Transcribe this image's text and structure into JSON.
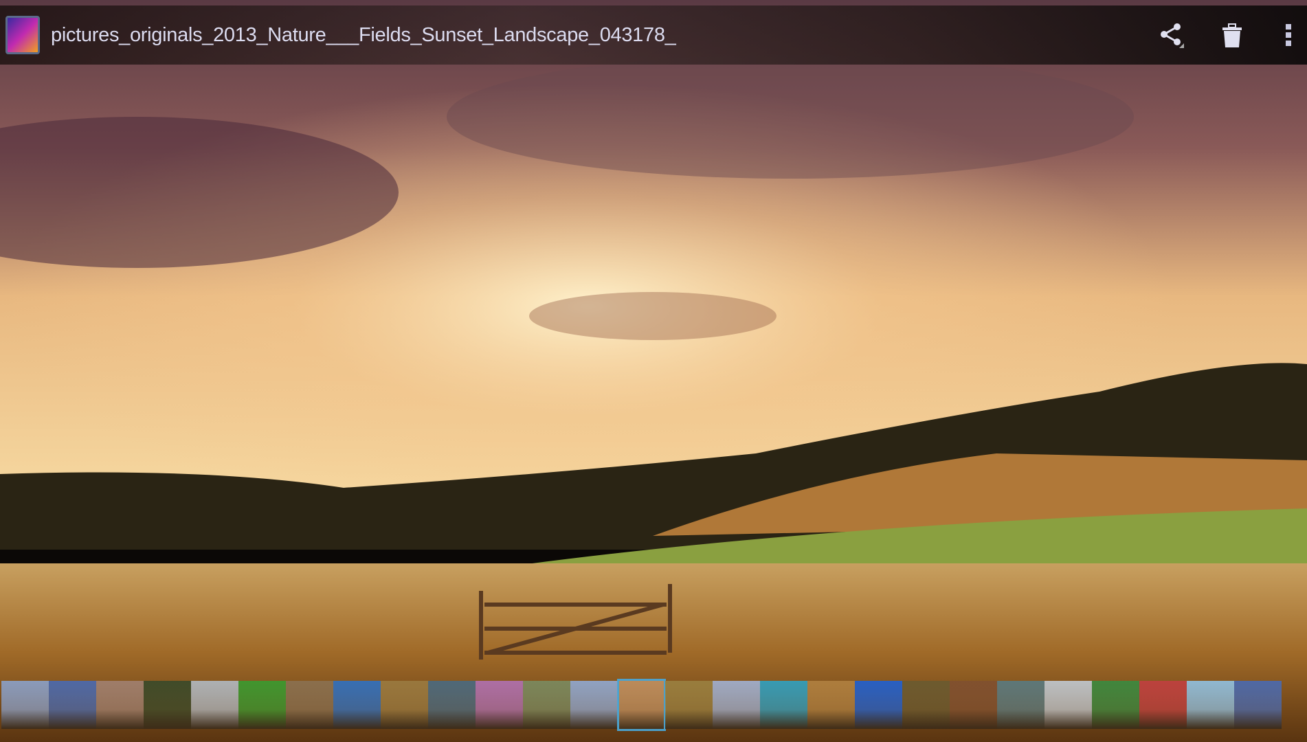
{
  "header": {
    "title": "pictures_originals_2013_Nature___Fields_Sunset_Landscape_043178_"
  },
  "actions": {
    "share": "share-icon",
    "delete": "trash-icon",
    "overflow": "more-vert-icon"
  },
  "filmstrip": {
    "selected_index": 13,
    "thumbnails": [
      "#8aa0c8",
      "#4a6ab0",
      "#a08070",
      "#3a4a2a",
      "#b0b8c0",
      "#3a9a30",
      "#8a7050",
      "#3070c0",
      "#9a7a40",
      "#4a6a80",
      "#b070b0",
      "#7a8a60",
      "#90a8d0",
      "#c09060",
      "#9a8040",
      "#a0b0d0",
      "#30a0c0",
      "#b08040",
      "#2060d0",
      "#6a5a30",
      "#805030",
      "#5a7a80",
      "#c0c8d0",
      "#3a8a40",
      "#c04040",
      "#90c0e0",
      "#4a6ab0"
    ]
  }
}
